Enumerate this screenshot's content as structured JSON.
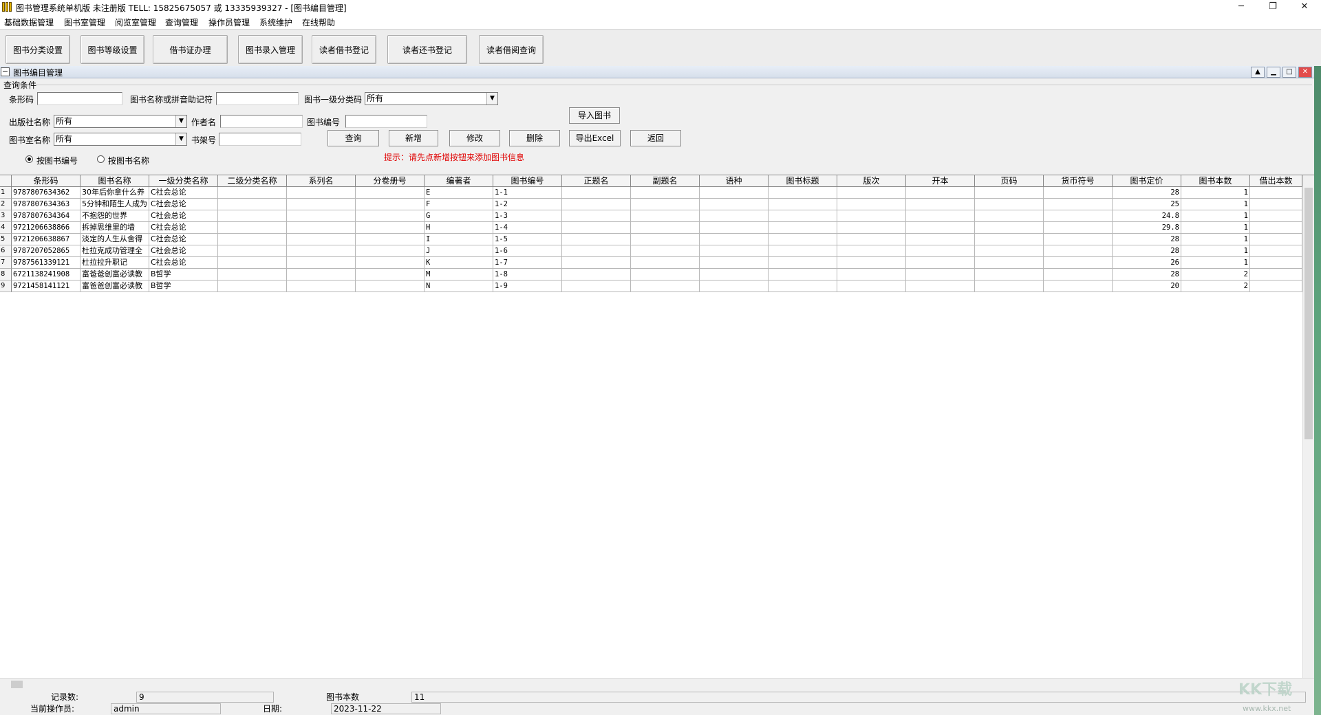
{
  "window": {
    "title": "图书管理系统单机版 未注册版 TELL: 15825675057 或 13335939327 - [图书编目管理]",
    "minimize": "─",
    "restore": "❐",
    "close": "✕"
  },
  "menu": [
    "基础数据管理",
    "图书室管理",
    "阅览室管理",
    "查询管理",
    "操作员管理",
    "系统维护",
    "在线帮助"
  ],
  "toolbar": [
    "图书分类设置",
    "图书等级设置",
    "借书证办理",
    "图书录入管理",
    "读者借书登记",
    "读者还书登记",
    "读者借阅查询"
  ],
  "child": {
    "title": "图书编目管理",
    "collapse": "−",
    "buttons": [
      "▲",
      "▁",
      "□",
      "✕"
    ]
  },
  "query": {
    "legend": "查询条件",
    "barcode_label": "条形码",
    "barcode_value": "",
    "name_label": "图书名称或拼音助记符",
    "name_value": "",
    "cat1_label": "图书一级分类码",
    "cat1_value": "所有",
    "publisher_label": "出版社名称",
    "publisher_value": "所有",
    "author_label": "作者名",
    "author_value": "",
    "bookno_label": "图书编号",
    "bookno_value": "",
    "room_label": "图书室名称",
    "room_value": "所有",
    "shelf_label": "书架号",
    "shelf_value": "",
    "radio_by_no": "按图书编号",
    "radio_by_name": "按图书名称",
    "btn_import": "导入图书",
    "btn_query": "查询",
    "btn_add": "新增",
    "btn_edit": "修改",
    "btn_delete": "删除",
    "btn_export": "导出Excel",
    "btn_back": "返回",
    "hint": "提示：请先点新增按钮来添加图书信息"
  },
  "grid": {
    "columns": [
      "条形码",
      "图书名称",
      "一级分类名称",
      "二级分类名称",
      "系列名",
      "分卷册号",
      "编著者",
      "图书编号",
      "正题名",
      "副题名",
      "语种",
      "图书标题",
      "版次",
      "开本",
      "页码",
      "货币符号",
      "图书定价",
      "图书本数",
      "借出本数"
    ],
    "rows": [
      {
        "n": "1",
        "barcode": "9787807634362",
        "name": "30年后你拿什么养",
        "cat1": "C社会总论",
        "author": "E",
        "no": "1-1",
        "price": "28",
        "count": "1"
      },
      {
        "n": "2",
        "barcode": "9787807634363",
        "name": "5分钟和陌生人成为",
        "cat1": "C社会总论",
        "author": "F",
        "no": "1-2",
        "price": "25",
        "count": "1"
      },
      {
        "n": "3",
        "barcode": "9787807634364",
        "name": "不抱怨的世界",
        "cat1": "C社会总论",
        "author": "G",
        "no": "1-3",
        "price": "24.8",
        "count": "1"
      },
      {
        "n": "4",
        "barcode": "9721206638866",
        "name": "拆掉思维里的墙",
        "cat1": "C社会总论",
        "author": "H",
        "no": "1-4",
        "price": "29.8",
        "count": "1"
      },
      {
        "n": "5",
        "barcode": "9721206638867",
        "name": "淡定的人生从舍得",
        "cat1": "C社会总论",
        "author": "I",
        "no": "1-5",
        "price": "28",
        "count": "1"
      },
      {
        "n": "6",
        "barcode": "9787207052865",
        "name": "杜拉克成功管理全",
        "cat1": "C社会总论",
        "author": "J",
        "no": "1-6",
        "price": "28",
        "count": "1"
      },
      {
        "n": "7",
        "barcode": "9787561339121",
        "name": "杜拉拉升职记",
        "cat1": "C社会总论",
        "author": "K",
        "no": "1-7",
        "price": "26",
        "count": "1"
      },
      {
        "n": "8",
        "barcode": "6721138241908",
        "name": "富爸爸创富必读教",
        "cat1": "B哲学",
        "author": "M",
        "no": "1-8",
        "price": "28",
        "count": "2"
      },
      {
        "n": "9",
        "barcode": "9721458141121",
        "name": "富爸爸创富必读教",
        "cat1": "B哲学",
        "author": "N",
        "no": "1-9",
        "price": "20",
        "count": "2"
      }
    ]
  },
  "status": {
    "records_label": "记录数:",
    "records_value": "9",
    "books_label": "图书本数",
    "books_value": "11",
    "operator_label": "当前操作员:",
    "operator_value": "admin",
    "date_label": "日期:",
    "date_value": "2023-11-22"
  },
  "watermark": {
    "logo": "KK下载",
    "url": "www.kkx.net"
  }
}
